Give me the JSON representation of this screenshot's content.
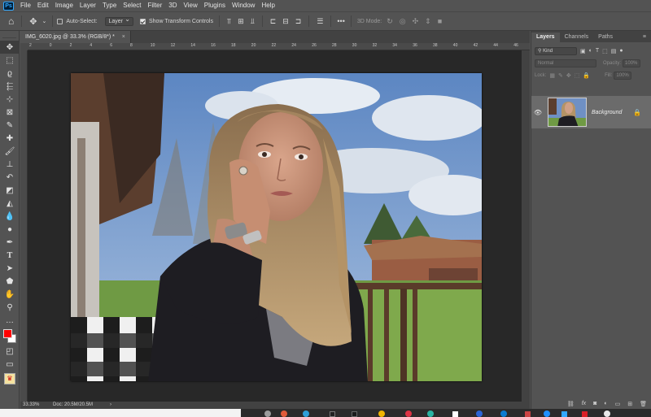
{
  "app": {
    "logo": "Ps"
  },
  "menu": [
    "File",
    "Edit",
    "Image",
    "Layer",
    "Type",
    "Select",
    "Filter",
    "3D",
    "View",
    "Plugins",
    "Window",
    "Help"
  ],
  "options": {
    "auto_select_label": "Auto-Select:",
    "auto_select_checked": false,
    "auto_select_target": "Layer",
    "show_transform_label": "Show Transform Controls",
    "show_transform_checked": true,
    "more_label": "•••",
    "mode_3d_label": "3D Mode:"
  },
  "document": {
    "tab_title": "IMG_6020.jpg @ 33.3% (RGB/8*) *",
    "tab_close": "×",
    "ruler_marks": [
      "2",
      "0",
      "2",
      "4",
      "6",
      "8",
      "10",
      "12",
      "14",
      "16",
      "18",
      "20",
      "22",
      "24",
      "26",
      "28",
      "30",
      "32",
      "34",
      "36",
      "38",
      "40",
      "42",
      "44",
      "46"
    ]
  },
  "status": {
    "zoom": "33.33%",
    "doc_size": "Doc: 20.5M/20.5M",
    "arrow": "›"
  },
  "layers_panel": {
    "tabs": [
      "Layers",
      "Channels",
      "Paths"
    ],
    "active_tab": "Layers",
    "search_placeholder": "Kind",
    "blend_mode": "Normal",
    "opacity_label": "Opacity:",
    "opacity_value": "100%",
    "lock_label": "Lock:",
    "fill_label": "Fill:",
    "fill_value": "100%",
    "layer_name": "Background",
    "bottom_icons": [
      "link-icon",
      "fx-icon",
      "mask-icon",
      "adjustment-icon",
      "folder-icon",
      "new-layer-icon",
      "trash-icon"
    ]
  },
  "colors": {
    "foreground": "#ff0000",
    "background": "#ffffff",
    "accent": "#31a8ff",
    "ui_bg": "#535353",
    "pasteboard": "#282828"
  }
}
